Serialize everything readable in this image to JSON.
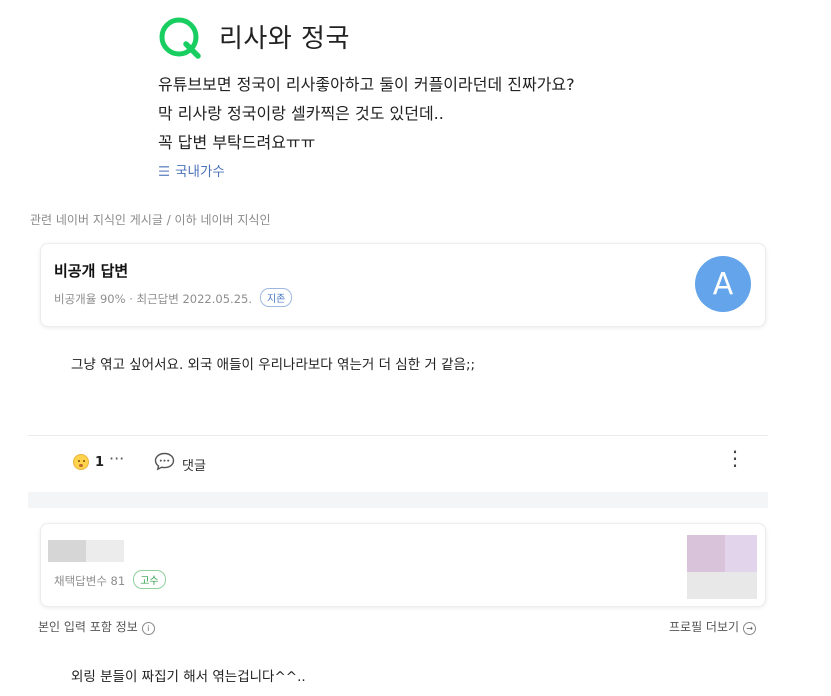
{
  "question": {
    "title": "리사와 정국",
    "body_lines": [
      "유튜브보면 정국이 리사좋아하고 둘이 커플이라던데 진짜가요?",
      "막 리사랑 정국이랑 셀카찍은 것도 있던데..",
      "꼭 답변 부탁드려요ㅠㅠ"
    ],
    "category": "국내가수",
    "category_icon": "list-icon",
    "brand_color": "#19ce60"
  },
  "related_label": "관련 네이버 지식인 게시글 / 이하 네이버 지식인",
  "answer_card_1": {
    "author": "비공개 답변",
    "meta": "비공개율 90% · 최근답변 2022.05.25.",
    "badge": "지존",
    "avatar_letter": "A",
    "avatar_color": "#63a4ea"
  },
  "answer_1_text": "그냥 엮고 싶어서요. 외국 애들이 우리나라보다 엮는거 더 심한 거 같음;;",
  "actions": {
    "reaction_count": "1",
    "more": "···",
    "comment_label": "댓글",
    "menu": "⋮"
  },
  "answer_card_2": {
    "meta": "채택답변수 81",
    "badge": "고수"
  },
  "info": {
    "left": "본인 입력 포함 정보",
    "info_icon": "i",
    "right": "프로필 더보기",
    "right_icon": "→"
  },
  "answer_2_text": "외링 분들이 짜집기 해서 엮는겁니다^^.."
}
